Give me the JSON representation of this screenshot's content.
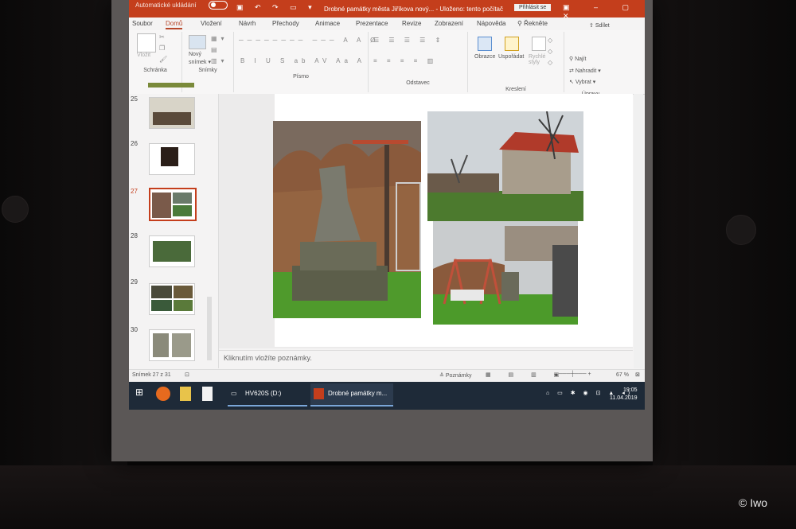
{
  "titlebar": {
    "autosave": "Automatické ukládání",
    "doc_title": "Drobné památky města Jiříkova nový...",
    "saved": " - Uloženo: tento počítač",
    "signin": "Přihlásit se"
  },
  "tabs": [
    "Soubor",
    "Domů",
    "Vložení",
    "Návrh",
    "Přechody",
    "Animace",
    "Prezentace",
    "Revize",
    "Zobrazení",
    "Nápověda",
    "Řekněte"
  ],
  "share": "Sdílet",
  "ribbon": {
    "clipboard": "Schránka",
    "paste": "Vložit",
    "new_slide_1": "Nový",
    "new_slide_2": "snímek",
    "slides": "Snímky",
    "font": "Písmo",
    "paragraph": "Odstavec",
    "shapes": "Obrazce",
    "arrange": "Uspořádat",
    "quick_styles": "Rychlé styly",
    "drawing": "Kreslení",
    "find": "Najít",
    "replace": "Nahradit",
    "select": "Vybrat",
    "editing": "Úpravy"
  },
  "slides": [
    "25",
    "26",
    "27",
    "28",
    "29",
    "30"
  ],
  "notes_placeholder": "Kliknutím vložíte poznámky.",
  "status": {
    "slide_count": "Snímek 27 z 31",
    "notes": "Poznámky",
    "zoom": "67 %"
  },
  "taskbar": {
    "drive": "HV620S (D:)",
    "ppt": "Drobné památky m...",
    "time": "19:05",
    "date": "11.04.2019"
  },
  "watermark": "© Iwo"
}
